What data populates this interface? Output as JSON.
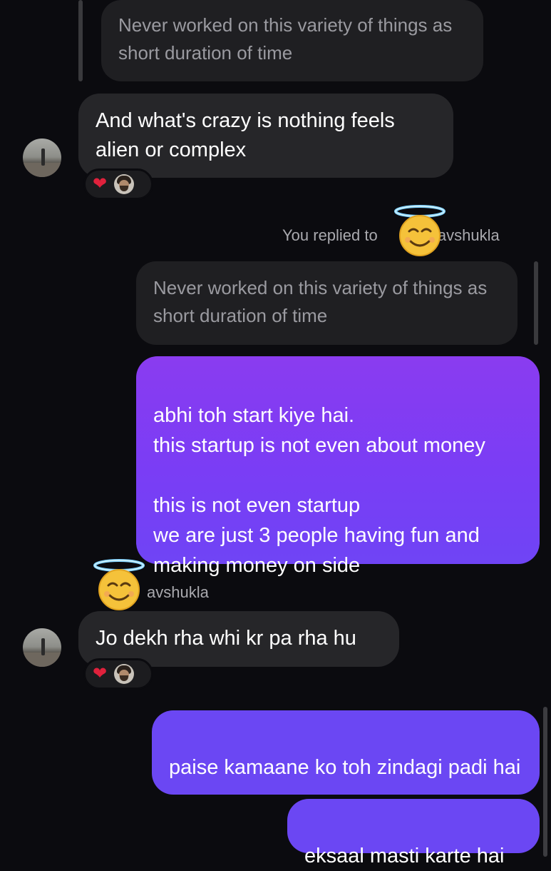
{
  "thread": {
    "quote_1": {
      "text": "Never worked on this variety of things as short duration of time"
    },
    "msg_in_1": {
      "text": "And what's crazy is nothing feels alien or complex",
      "reactions": [
        "heart-emoji",
        "user-avatar"
      ]
    },
    "reply_meta": {
      "prefix": "You replied to ",
      "name_suffix": "avshukla"
    },
    "quote_2": {
      "text": "Never worked on this variety of things as short duration of time"
    },
    "msg_out_1": {
      "text": "abhi toh start kiye hai.\nthis startup is not even about money\n\nthis is not even startup\nwe are just 3 people having fun and making money on side"
    },
    "sender_meta": {
      "name_suffix": "avshukla"
    },
    "msg_in_2": {
      "text": "Jo dekh rha whi kr pa rha hu",
      "reactions": [
        "heart-emoji",
        "user-avatar"
      ]
    },
    "msg_out_2": {
      "text": "paise kamaane ko toh zindagi padi hai"
    },
    "msg_out_3": {
      "text": "eksaal masti karte hai"
    }
  },
  "colors": {
    "background": "#0b0b0f",
    "incoming_bubble": "#262629",
    "quoted_bubble": "#1f1f22",
    "outgoing_gradient_top": "#8a3cf0",
    "outgoing_gradient_bottom": "#6f44f5",
    "heart": "#e0213c"
  },
  "icons": {
    "halo_emoji": "smiling-face-with-halo-icon",
    "heart": "heart-icon"
  }
}
